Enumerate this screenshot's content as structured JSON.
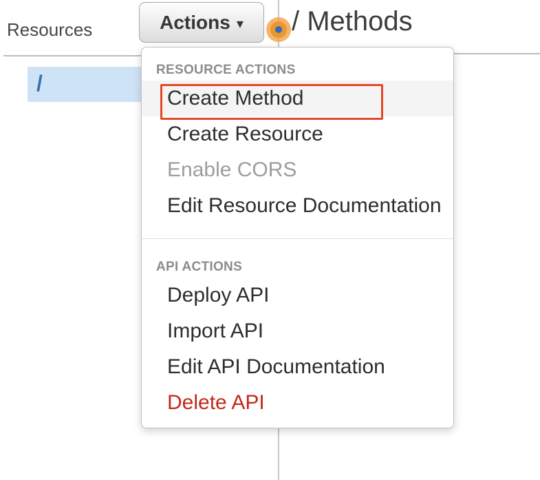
{
  "left_panel": {
    "title": "Resources",
    "selected_resource": "/"
  },
  "toolbar": {
    "actions_label": "Actions",
    "caret_icon": "▾"
  },
  "right_panel": {
    "title": "/ Methods"
  },
  "dropdown": {
    "sections": [
      {
        "header": "RESOURCE ACTIONS",
        "items": [
          {
            "label": "Create Method",
            "state": "highlighted"
          },
          {
            "label": "Create Resource",
            "state": "normal"
          },
          {
            "label": "Enable CORS",
            "state": "disabled"
          },
          {
            "label": "Edit Resource Documentation",
            "state": "normal"
          }
        ]
      },
      {
        "header": "API ACTIONS",
        "items": [
          {
            "label": "Deploy API",
            "state": "normal"
          },
          {
            "label": "Import API",
            "state": "normal"
          },
          {
            "label": "Edit API Documentation",
            "state": "normal"
          },
          {
            "label": "Delete API",
            "state": "danger"
          }
        ]
      }
    ]
  },
  "annotations": {
    "highlight_box_target": "Create Method",
    "click_indicator_target": "Actions"
  },
  "colors": {
    "selected_row_bg": "#cfe3f7",
    "selected_row_text": "#3b71a9",
    "menu_text": "#2d2d2d",
    "menu_disabled_text": "#9d9d9d",
    "menu_danger_text": "#c2291a",
    "section_header_text": "#8b8b8b",
    "annotation_red": "#e8462c",
    "click_indicator_orange": "#eb9630",
    "click_indicator_blue": "#2e6cc0"
  }
}
